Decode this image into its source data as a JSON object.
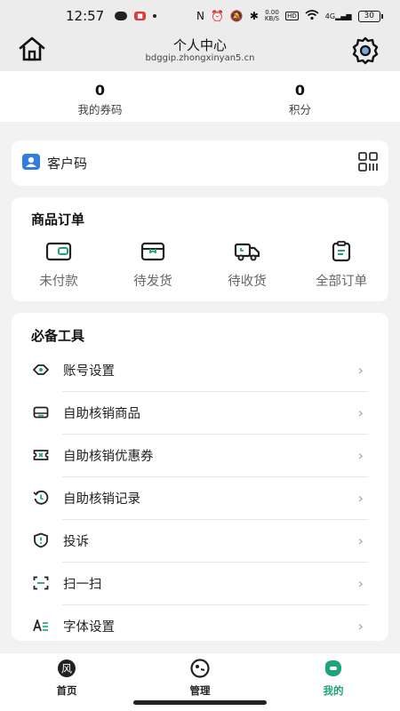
{
  "status_bar": {
    "time": "12:57",
    "network_speed": "0.00",
    "network_unit": "KB/S",
    "hd": "HD",
    "signal": "4G",
    "battery": "30"
  },
  "header": {
    "title": "个人中心",
    "subtitle": "bdggip.zhongxinyan5.cn"
  },
  "stats": {
    "coupons": {
      "value": "0",
      "label": "我的券码"
    },
    "points": {
      "value": "0",
      "label": "积分"
    }
  },
  "customer_code": {
    "label": "客户码"
  },
  "orders": {
    "title": "商品订单",
    "items": [
      {
        "label": "未付款",
        "icon": "wallet-icon"
      },
      {
        "label": "待发货",
        "icon": "package-box-icon"
      },
      {
        "label": "待收货",
        "icon": "delivery-truck-icon"
      },
      {
        "label": "全部订单",
        "icon": "clipboard-icon"
      }
    ]
  },
  "tools": {
    "title": "必备工具",
    "items": [
      {
        "label": "账号设置",
        "icon": "eye-icon"
      },
      {
        "label": "自助核销商品",
        "icon": "product-icon"
      },
      {
        "label": "自助核销优惠券",
        "icon": "ticket-icon"
      },
      {
        "label": "自助核销记录",
        "icon": "history-icon"
      },
      {
        "label": "投诉",
        "icon": "shield-alert-icon"
      },
      {
        "label": "扫一扫",
        "icon": "scan-icon"
      },
      {
        "label": "字体设置",
        "icon": "font-size-icon"
      }
    ]
  },
  "tabbar": {
    "items": [
      {
        "label": "首页",
        "icon_text": "风"
      },
      {
        "label": "管理"
      },
      {
        "label": "我的"
      }
    ],
    "active_color": "#1fa37a"
  }
}
